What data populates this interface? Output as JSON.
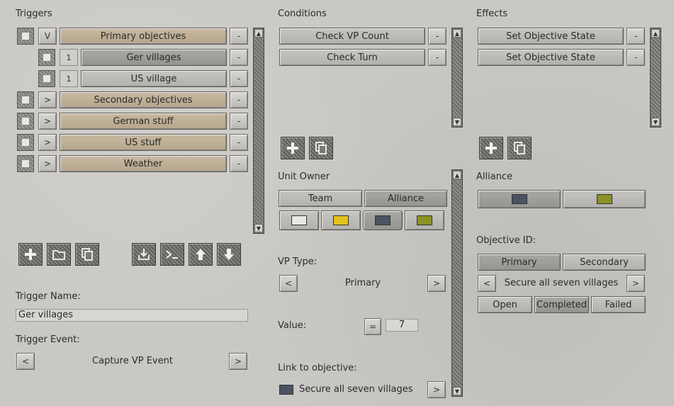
{
  "triggers": {
    "heading": "Triggers",
    "rows": [
      {
        "expand": "V",
        "label": "Primary objectives",
        "style": "tan",
        "indent": false,
        "remove": "-"
      },
      {
        "num": "1",
        "label": "Ger villages",
        "style": "dark",
        "indent": true,
        "remove": "-"
      },
      {
        "num": "1",
        "label": "US village",
        "style": "gray",
        "indent": true,
        "remove": "-"
      },
      {
        "expand": ">",
        "label": "Secondary objectives",
        "style": "tan",
        "indent": false,
        "remove": "-"
      },
      {
        "expand": ">",
        "label": "German stuff",
        "style": "tan",
        "indent": false,
        "remove": "-"
      },
      {
        "expand": ">",
        "label": "US stuff",
        "style": "tan",
        "indent": false,
        "remove": "-"
      },
      {
        "expand": ">",
        "label": "Weather",
        "style": "tan",
        "indent": false,
        "remove": "-"
      }
    ],
    "name_label": "Trigger Name:",
    "name_value": "Ger villages",
    "event_label": "Trigger Event:",
    "event_value": "Capture VP Event",
    "prev": "<",
    "next": ">"
  },
  "conditions": {
    "heading": "Conditions",
    "items": [
      {
        "label": "Check VP Count",
        "remove": "-"
      },
      {
        "label": "Check Turn",
        "remove": "-"
      }
    ]
  },
  "effects": {
    "heading": "Effects",
    "items": [
      {
        "label": "Set Objective State",
        "remove": "-"
      },
      {
        "label": "Set Objective State",
        "remove": "-"
      }
    ]
  },
  "unit_owner": {
    "label": "Unit Owner",
    "team": "Team",
    "alliance": "Alliance",
    "colors": [
      "#e9e8e6",
      "#e4c21d",
      "#4a5361",
      "#8c9226"
    ]
  },
  "vp_type": {
    "label": "VP Type:",
    "value": "Primary",
    "prev": "<",
    "next": ">"
  },
  "value": {
    "label": "Value:",
    "op": "=",
    "number": "7"
  },
  "link": {
    "label": "Link to objective:",
    "value": "Secure all seven villages",
    "swatch": "#4a5361",
    "next": ">"
  },
  "alliance": {
    "label": "Alliance",
    "colors": [
      "#4a5361",
      "#8c9226"
    ]
  },
  "objective": {
    "label": "Objective ID:",
    "primary": "Primary",
    "secondary": "Secondary",
    "value": "Secure all seven villages",
    "prev": "<",
    "next": ">",
    "open": "Open",
    "completed": "Completed",
    "failed": "Failed"
  }
}
